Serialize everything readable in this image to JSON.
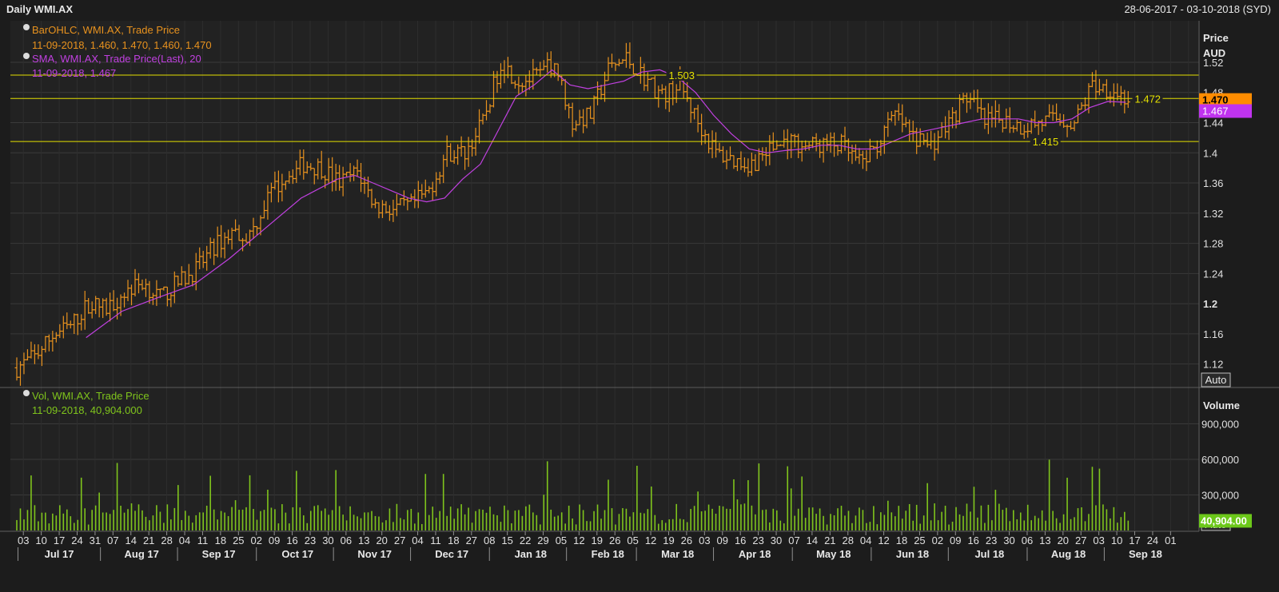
{
  "header": {
    "title": "Daily WMI.AX",
    "date_range": "28-06-2017 - 03-10-2018 (SYD)"
  },
  "colors": {
    "background": "#1c1c1c",
    "panel": "#222222",
    "grid": "#3a3a3a",
    "bar": "#e8921e",
    "sma": "#c040e0",
    "volume": "#7fc41c",
    "hline": "#e4e000",
    "last_price_badge": "#ff8c00",
    "sma_badge": "#c033ef",
    "volume_badge": "#6cc81a"
  },
  "legend": {
    "ohlc_title": "BarOHLC, WMI.AX, Trade Price",
    "ohlc_values": "11-09-2018, 1.460, 1.470, 1.460, 1.470",
    "sma_title": "SMA, WMI.AX, Trade Price(Last),  20",
    "sma_values": "11-09-2018, 1.467",
    "vol_title": "Vol, WMI.AX, Trade Price",
    "vol_values": "11-09-2018, 40,904.000"
  },
  "price_axis": {
    "title_line1": "Price",
    "title_line2": "AUD",
    "auto_label": "Auto"
  },
  "volume_axis": {
    "title": "Volume",
    "auto_label": "Auto"
  },
  "chart_data": {
    "type": "ohlc",
    "ticker": "WMI.AX",
    "price": {
      "ylim": [
        1.09,
        1.575
      ],
      "ticks": [
        {
          "value": 1.12,
          "label": "1.12"
        },
        {
          "value": 1.16,
          "label": "1.16"
        },
        {
          "value": 1.2,
          "label": "1.2",
          "bold": true
        },
        {
          "value": 1.24,
          "label": "1.24"
        },
        {
          "value": 1.28,
          "label": "1.28"
        },
        {
          "value": 1.32,
          "label": "1.32"
        },
        {
          "value": 1.36,
          "label": "1.36"
        },
        {
          "value": 1.4,
          "label": "1.4"
        },
        {
          "value": 1.44,
          "label": "1.44"
        },
        {
          "value": 1.48,
          "label": "1.48"
        },
        {
          "value": 1.52,
          "label": "1.52"
        }
      ],
      "close_path": [
        {
          "week": 0,
          "value": 1.115
        },
        {
          "week": 1,
          "value": 1.13
        },
        {
          "week": 2,
          "value": 1.158
        },
        {
          "week": 3,
          "value": 1.17
        },
        {
          "week": 4,
          "value": 1.2
        },
        {
          "week": 5,
          "value": 1.193
        },
        {
          "week": 6,
          "value": 1.215
        },
        {
          "week": 7,
          "value": 1.228
        },
        {
          "week": 8,
          "value": 1.208
        },
        {
          "week": 9,
          "value": 1.228
        },
        {
          "week": 10,
          "value": 1.245
        },
        {
          "week": 11,
          "value": 1.275
        },
        {
          "week": 12,
          "value": 1.295
        },
        {
          "week": 13,
          "value": 1.29
        },
        {
          "week": 14,
          "value": 1.34
        },
        {
          "week": 15,
          "value": 1.37
        },
        {
          "week": 16,
          "value": 1.385
        },
        {
          "week": 17,
          "value": 1.38
        },
        {
          "week": 18,
          "value": 1.36
        },
        {
          "week": 19,
          "value": 1.375
        },
        {
          "week": 20,
          "value": 1.33
        },
        {
          "week": 21,
          "value": 1.325
        },
        {
          "week": 22,
          "value": 1.33
        },
        {
          "week": 23,
          "value": 1.35
        },
        {
          "week": 24,
          "value": 1.4
        },
        {
          "week": 25,
          "value": 1.4
        },
        {
          "week": 26,
          "value": 1.44
        },
        {
          "week": 27,
          "value": 1.52
        },
        {
          "week": 28,
          "value": 1.495
        },
        {
          "week": 29,
          "value": 1.5
        },
        {
          "week": 30,
          "value": 1.52
        },
        {
          "week": 31,
          "value": 1.44
        },
        {
          "week": 32,
          "value": 1.45
        },
        {
          "week": 33,
          "value": 1.51
        },
        {
          "week": 34,
          "value": 1.525
        },
        {
          "week": 35,
          "value": 1.5
        },
        {
          "week": 36,
          "value": 1.475
        },
        {
          "week": 37,
          "value": 1.49
        },
        {
          "week": 38,
          "value": 1.44
        },
        {
          "week": 39,
          "value": 1.4
        },
        {
          "week": 40,
          "value": 1.39
        },
        {
          "week": 41,
          "value": 1.385
        },
        {
          "week": 42,
          "value": 1.405
        },
        {
          "week": 43,
          "value": 1.415
        },
        {
          "week": 44,
          "value": 1.41
        },
        {
          "week": 45,
          "value": 1.41
        },
        {
          "week": 46,
          "value": 1.41
        },
        {
          "week": 47,
          "value": 1.385
        },
        {
          "week": 48,
          "value": 1.41
        },
        {
          "week": 49,
          "value": 1.45
        },
        {
          "week": 50,
          "value": 1.42
        },
        {
          "week": 51,
          "value": 1.41
        },
        {
          "week": 52,
          "value": 1.44
        },
        {
          "week": 53,
          "value": 1.475
        },
        {
          "week": 54,
          "value": 1.44
        },
        {
          "week": 55,
          "value": 1.445
        },
        {
          "week": 56,
          "value": 1.435
        },
        {
          "week": 57,
          "value": 1.44
        },
        {
          "week": 58,
          "value": 1.445
        },
        {
          "week": 59,
          "value": 1.44
        },
        {
          "week": 60,
          "value": 1.49
        },
        {
          "week": 61,
          "value": 1.485
        },
        {
          "week": 62,
          "value": 1.47
        }
      ],
      "sma_path": [
        {
          "week": 4,
          "value": 1.155
        },
        {
          "week": 6,
          "value": 1.19
        },
        {
          "week": 8,
          "value": 1.208
        },
        {
          "week": 10,
          "value": 1.225
        },
        {
          "week": 12,
          "value": 1.26
        },
        {
          "week": 14,
          "value": 1.3
        },
        {
          "week": 16,
          "value": 1.34
        },
        {
          "week": 18,
          "value": 1.365
        },
        {
          "week": 19,
          "value": 1.37
        },
        {
          "week": 20,
          "value": 1.36
        },
        {
          "week": 22,
          "value": 1.34
        },
        {
          "week": 23,
          "value": 1.335
        },
        {
          "week": 24,
          "value": 1.34
        },
        {
          "week": 25,
          "value": 1.365
        },
        {
          "week": 26,
          "value": 1.385
        },
        {
          "week": 27,
          "value": 1.43
        },
        {
          "week": 28,
          "value": 1.475
        },
        {
          "week": 29,
          "value": 1.49
        },
        {
          "week": 30,
          "value": 1.51
        },
        {
          "week": 31,
          "value": 1.49
        },
        {
          "week": 32,
          "value": 1.485
        },
        {
          "week": 33,
          "value": 1.49
        },
        {
          "week": 34,
          "value": 1.495
        },
        {
          "week": 35,
          "value": 1.507
        },
        {
          "week": 36,
          "value": 1.51
        },
        {
          "week": 37,
          "value": 1.5
        },
        {
          "week": 38,
          "value": 1.48
        },
        {
          "week": 39,
          "value": 1.45
        },
        {
          "week": 40,
          "value": 1.425
        },
        {
          "week": 41,
          "value": 1.405
        },
        {
          "week": 42,
          "value": 1.4
        },
        {
          "week": 43,
          "value": 1.403
        },
        {
          "week": 44,
          "value": 1.405
        },
        {
          "week": 45,
          "value": 1.41
        },
        {
          "week": 46,
          "value": 1.41
        },
        {
          "week": 47,
          "value": 1.405
        },
        {
          "week": 48,
          "value": 1.405
        },
        {
          "week": 49,
          "value": 1.415
        },
        {
          "week": 50,
          "value": 1.425
        },
        {
          "week": 51,
          "value": 1.43
        },
        {
          "week": 52,
          "value": 1.435
        },
        {
          "week": 53,
          "value": 1.44
        },
        {
          "week": 54,
          "value": 1.445
        },
        {
          "week": 55,
          "value": 1.445
        },
        {
          "week": 56,
          "value": 1.445
        },
        {
          "week": 57,
          "value": 1.44
        },
        {
          "week": 58,
          "value": 1.44
        },
        {
          "week": 59,
          "value": 1.445
        },
        {
          "week": 60,
          "value": 1.46
        },
        {
          "week": 61,
          "value": 1.468
        },
        {
          "week": 62,
          "value": 1.467
        }
      ],
      "horizontal_lines": [
        {
          "value": 1.503,
          "label": "1.503",
          "label_week": 36.5
        },
        {
          "value": 1.472,
          "label": "1.472",
          "label_week": 62.5
        },
        {
          "value": 1.415,
          "label": "1.415",
          "label_week": 56.8
        }
      ],
      "last_price": {
        "value": 1.47,
        "label": "1.470"
      },
      "sma_last": {
        "value": 1.467,
        "label": "1.467"
      }
    },
    "volume": {
      "ylim": [
        0,
        1200000
      ],
      "ticks": [
        {
          "value": 300000,
          "label": "300,000"
        },
        {
          "value": 600000,
          "label": "600,000"
        },
        {
          "value": 900000,
          "label": "900,000"
        }
      ],
      "last": {
        "value": 40904,
        "label": "40,904.00"
      }
    },
    "x_axis": {
      "week_count": 66,
      "day_labels": [
        "03",
        "10",
        "17",
        "24",
        "31",
        "07",
        "14",
        "21",
        "28",
        "04",
        "11",
        "18",
        "25",
        "02",
        "09",
        "16",
        "23",
        "30",
        "06",
        "13",
        "20",
        "27",
        "04",
        "11",
        "18",
        "27",
        "08",
        "15",
        "22",
        "29",
        "05",
        "12",
        "19",
        "26",
        "05",
        "12",
        "19",
        "26",
        "03",
        "09",
        "16",
        "23",
        "30",
        "07",
        "14",
        "21",
        "28",
        "04",
        "12",
        "18",
        "25",
        "02",
        "09",
        "16",
        "23",
        "30",
        "06",
        "13",
        "20",
        "27",
        "03",
        "10",
        "17",
        "24",
        "01"
      ],
      "months": [
        {
          "label": "Jul 17",
          "week": 2
        },
        {
          "label": "Aug 17",
          "week": 6.6
        },
        {
          "label": "Sep 17",
          "week": 10.9
        },
        {
          "label": "Oct 17",
          "week": 15.3
        },
        {
          "label": "Nov 17",
          "week": 19.6
        },
        {
          "label": "Dec 17",
          "week": 23.9
        },
        {
          "label": "Jan 18",
          "week": 28.3
        },
        {
          "label": "Feb 18",
          "week": 32.6
        },
        {
          "label": "Mar 18",
          "week": 36.5
        },
        {
          "label": "Apr 18",
          "week": 40.8
        },
        {
          "label": "May 18",
          "week": 45.2
        },
        {
          "label": "Jun 18",
          "week": 49.6
        },
        {
          "label": "Jul 18",
          "week": 53.9
        },
        {
          "label": "Aug 18",
          "week": 58.3
        },
        {
          "label": "Sep 18",
          "week": 62.6
        }
      ]
    }
  }
}
